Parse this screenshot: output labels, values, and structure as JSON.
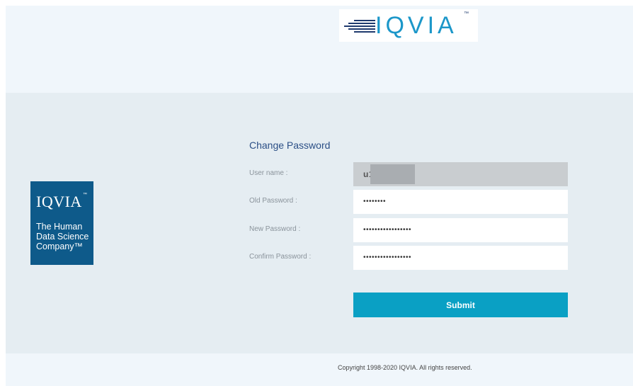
{
  "header": {
    "logo_text": "IQVIA",
    "logo_tm": "™"
  },
  "side_badge": {
    "logo_text": "IQVIA",
    "logo_tm": "™",
    "tagline_line1": "The Human",
    "tagline_line2": "Data Science",
    "tagline_line3": "Company™"
  },
  "form": {
    "title": "Change Password",
    "fields": [
      {
        "label": "User name :",
        "value": "u1",
        "masked": false,
        "readonly": true
      },
      {
        "label": "Old Password :",
        "value": "••••••••",
        "masked": true,
        "readonly": false
      },
      {
        "label": "New Password :",
        "value": "•••••••••••••••••",
        "masked": true,
        "readonly": false
      },
      {
        "label": "Confirm Password :",
        "value": "•••••••••••••••••",
        "masked": true,
        "readonly": false
      }
    ],
    "submit_label": "Submit"
  },
  "footer": {
    "copyright": "Copyright 1998-2020 IQVIA. All rights reserved."
  },
  "colors": {
    "brand_blue": "#1c97c9",
    "brand_navy": "#0e5a8a",
    "submit_button": "#0aa0c4",
    "title_text": "#2b4f86"
  }
}
